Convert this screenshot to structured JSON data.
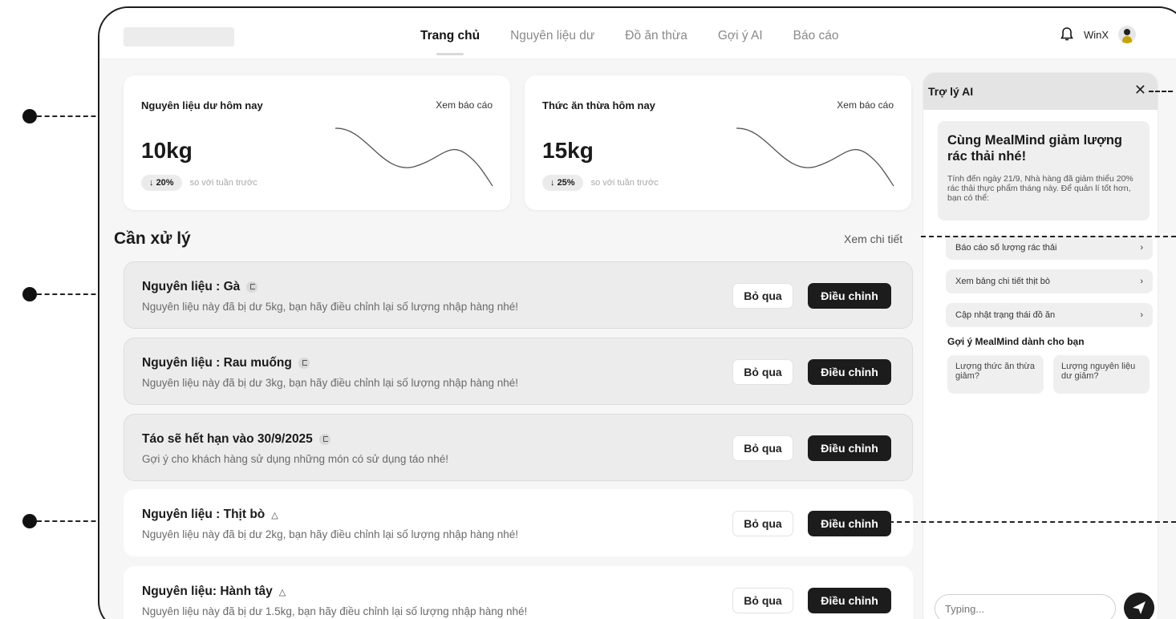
{
  "nav": {
    "items": [
      "Trang chủ",
      "Nguyên liệu dư",
      "Đồ ăn thừa",
      "Gợi ý AI",
      "Báo cáo"
    ],
    "active_index": 0
  },
  "user": {
    "name": "WinX"
  },
  "stats": [
    {
      "title": "Nguyên liệu dư hôm nay",
      "link": "Xem báo cáo",
      "value": "10kg",
      "change": "20%",
      "change_direction": "down",
      "note": "so với tuần trước"
    },
    {
      "title": "Thức ăn thừa hôm nay",
      "link": "Xem báo cáo",
      "value": "15kg",
      "change": "25%",
      "change_direction": "down",
      "note": "so với tuần trước"
    }
  ],
  "section": {
    "title": "Cần xử lý",
    "link": "Xem chi tiết"
  },
  "tasks": [
    {
      "title": "Nguyên liệu : Gà",
      "desc": "Nguyên liệu này đã bị dư 5kg, bạn hãy điều chỉnh lại số lượng nhập hàng nhé!",
      "icon": "flag-icon"
    },
    {
      "title": "Nguyên liệu : Rau muống",
      "desc": "Nguyên liệu này đã bị dư 3kg, bạn hãy điều chỉnh lại số lượng nhập hàng nhé!",
      "icon": "flag-icon"
    },
    {
      "title": "Táo sẽ hết hạn vào 30/9/2025",
      "desc": "Gợi ý cho khách hàng sử dụng những món có sử dụng táo nhé!",
      "icon": "flag-icon"
    },
    {
      "title": "Nguyên liệu : Thịt bò",
      "desc": "Nguyên liệu này đã bị dư 2kg, bạn hãy điều chỉnh lại số lượng nhập hàng nhé!",
      "icon": "warning-icon"
    },
    {
      "title": "Nguyên liệu: Hành tây",
      "desc": "Nguyên liệu này đã bị dư 1.5kg, bạn hãy điều chỉnh lại số lượng nhập hàng nhé!",
      "icon": "warning-icon"
    }
  ],
  "task_buttons": {
    "skip": "Bỏ qua",
    "adjust": "Điều chỉnh"
  },
  "ai": {
    "title": "Trợ lý AI",
    "intro_title": "Cùng MealMind giảm lượng rác thải nhé!",
    "intro_text": "Tính đến ngày 21/9, Nhà hàng đã giảm thiểu 20% rác thải thực phẩm tháng này. Để quản lí tốt hơn, bạn có thể:",
    "actions": [
      "Báo cáo số lượng rác thải",
      "Xem bảng chi tiết thịt bò",
      "Cập nhật trạng thái đồ ăn"
    ],
    "suggest_title": "Gợi ý MealMind dành cho bạn",
    "chips": [
      "Lượng thức ăn thừa giảm?",
      "Lượng nguyên liệu dư giảm?"
    ],
    "input_placeholder": "Typing..."
  }
}
